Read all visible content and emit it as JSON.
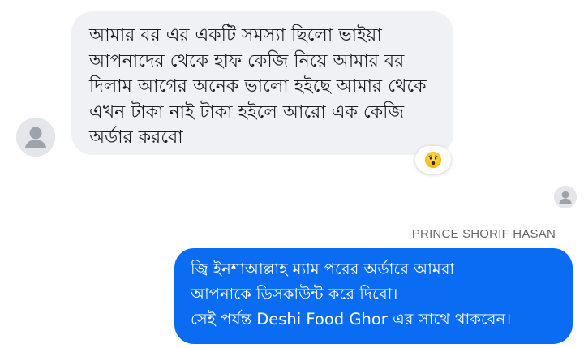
{
  "incoming": {
    "lines": [
      "আমার বর এর একটি সমস্যা ছিলো ভাইয়া",
      "আপনাদের থেকে হাফ কেজি নিয়ে আমার বর",
      "দিলাম আগের অনেক ভালো হইছে আমার থেকে",
      "এখন টাকা নাই টাকা হইলে আরো এক কেজি",
      "অর্ডার করবো"
    ],
    "reaction": "wow-emoji-icon"
  },
  "outgoing": {
    "sender": "PRINCE SHORIF HASAN",
    "lines": [
      "জ্বি ইনশাআল্লাহ ম্যাম পরের অর্ডারে আমরা",
      "আপনাকে ডিসকাউন্ট করে দিবো।",
      "সেই পর্যন্ত Deshi Food  Ghor এর সাথে থাকবেন।"
    ]
  },
  "colors": {
    "incoming_bubble": "#f0f1f5",
    "outgoing_bubble": "#0a6cf2",
    "sender_text": "#65676b"
  }
}
